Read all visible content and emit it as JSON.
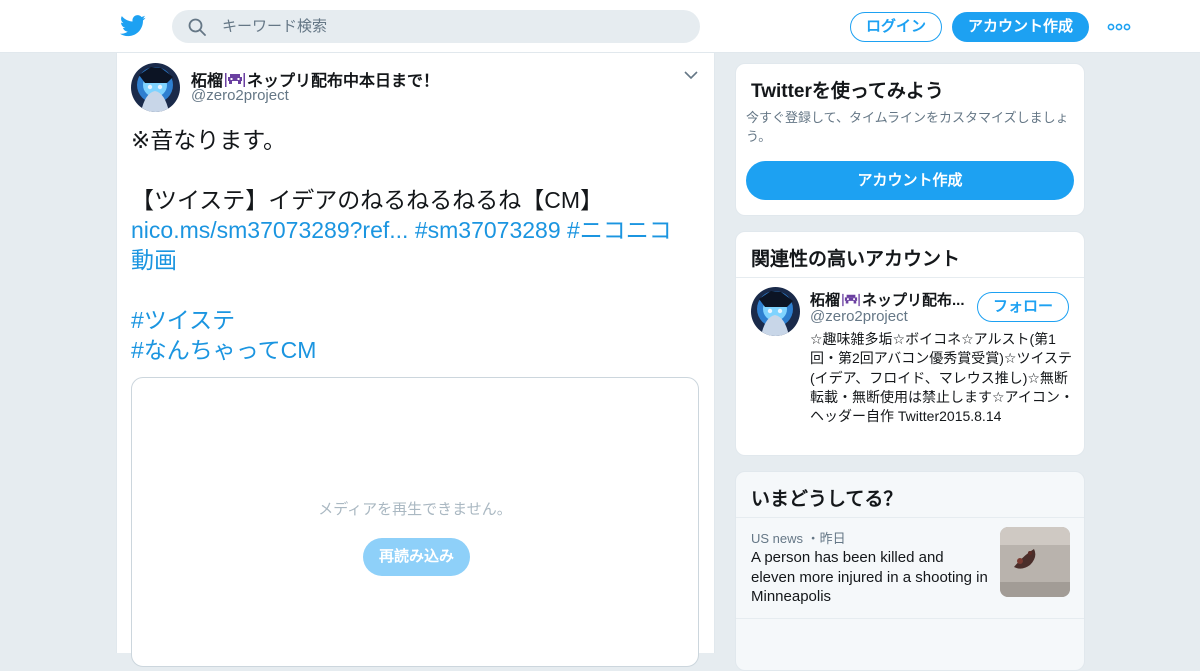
{
  "colors": {
    "brand": "#1da1f2",
    "link": "#1b95e0",
    "page_background": "#e6ecf0",
    "muted_text": "#657786"
  },
  "header": {
    "logo_icon": "twitter-bird-icon",
    "search": {
      "icon": "search-icon",
      "placeholder": "キーワード検索"
    },
    "login_label": "ログイン",
    "signup_label": "アカウント作成",
    "more_icon": "more-dots-icon"
  },
  "tweet": {
    "author": {
      "name_prefix": "柘榴",
      "name_emoji": "space-invader-icon",
      "name_suffix": "ネップリ配布中本日まで！",
      "handle": "@zero2project",
      "avatar": "avatar-image"
    },
    "menu_icon": "chevron-down-icon",
    "text_line1": "※音なります。",
    "text_line2": "【ツイステ】イデアのねるねるねるね【CM】",
    "link_url": "nico.ms/sm37073289?ref...",
    "hashtag1": "#sm37073289",
    "hashtag2_line1": "#ニコニコ",
    "hashtag2_line2": "動画",
    "hashtag3": "#ツイステ",
    "hashtag4": "#なんちゃってCM",
    "media": {
      "message": "メディアを再生できません。",
      "reload_label": "再読み込み"
    }
  },
  "sidebar": {
    "signup_card": {
      "title": "Twitterを使ってみよう",
      "description": "今すぐ登録して、タイムラインをカスタマイズしましょう。",
      "button_label": "アカウント作成"
    },
    "related_card": {
      "title": "関連性の高いアカウント",
      "account": {
        "name_prefix": "柘榴",
        "name_suffix": "ネップリ配布...",
        "handle": "@zero2project",
        "follow_label": "フォロー",
        "bio": "☆趣味雑多垢☆ボイコネ☆アルスト(第1回・第2回アバコン優秀賞受賞)☆ツイステ(イデア、フロイド、マレウス推し)☆無断転載・無断使用は禁止します☆アイコン・ヘッダー自作 Twitter2015.8.14"
      }
    },
    "trends_card": {
      "title": "いまどうしてる？",
      "item": {
        "category": "US news",
        "separator": "・",
        "time": "昨日",
        "text": "A person has been killed and eleven more injured in a shooting in Minneapolis",
        "thumbnail": "news-photo"
      }
    }
  }
}
